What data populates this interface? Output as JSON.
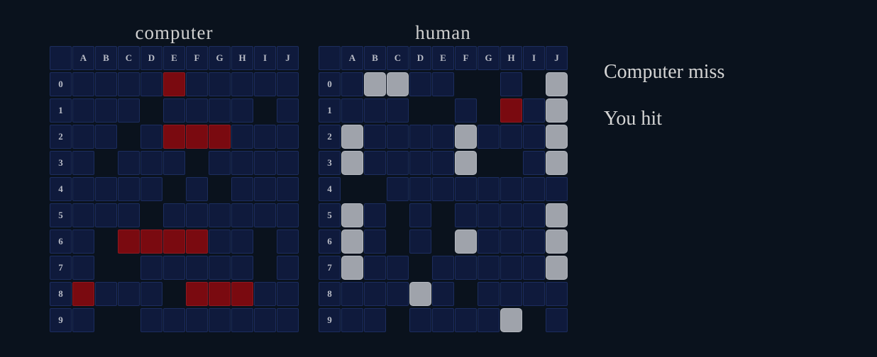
{
  "boards": [
    {
      "id": "computer",
      "title": "computer",
      "columns": [
        "A",
        "B",
        "C",
        "D",
        "E",
        "F",
        "G",
        "H",
        "I",
        "J"
      ],
      "rows": [
        "0",
        "1",
        "2",
        "3",
        "4",
        "5",
        "6",
        "7",
        "8",
        "9"
      ],
      "grid": [
        "....X.....",
        "...-....-.",
        "..-.XXX...",
        ".-...-....",
        "....-.-...",
        "...-......",
        ".-XXXX..-.",
        ".--.....-.",
        "X...-XXX..",
        ".--......."
      ]
    },
    {
      "id": "human",
      "title": "human",
      "columns": [
        "A",
        "B",
        "C",
        "D",
        "E",
        "F",
        "G",
        "H",
        "I",
        "J"
      ],
      "rows": [
        "0",
        "1",
        "2",
        "3",
        "4",
        "5",
        "6",
        "7",
        "8",
        "9"
      ],
      "grid": [
        ".SS..--.-S",
        "...--.-X.S",
        "S....S...S",
        "S....S--.S",
        "--........",
        "S.-.-....S",
        "S.-.-S...S",
        "S..-.....S",
        "...S.-....",
        "..-....S-."
      ]
    }
  ],
  "legend": {
    ".": "sea",
    "-": "empty",
    "X": "hit",
    "S": "ship"
  },
  "messages": {
    "computer_result": "Computer miss",
    "player_result": "You hit"
  }
}
